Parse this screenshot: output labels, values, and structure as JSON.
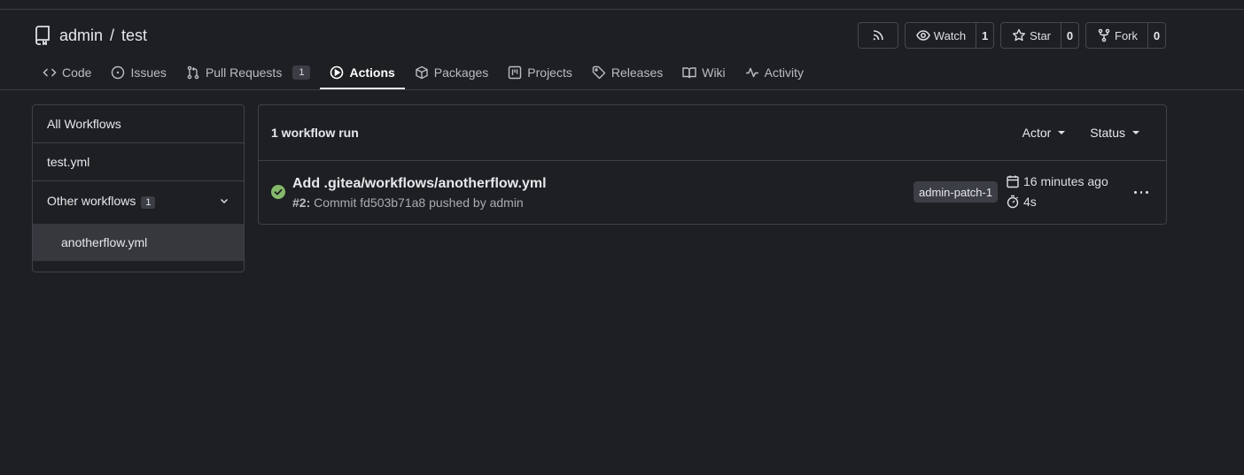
{
  "repo": {
    "owner": "admin",
    "separator": "/",
    "name": "test"
  },
  "actions": {
    "watch": {
      "label": "Watch",
      "count": "1"
    },
    "star": {
      "label": "Star",
      "count": "0"
    },
    "fork": {
      "label": "Fork",
      "count": "0"
    }
  },
  "tabs": [
    {
      "label": "Code",
      "icon": "code-icon"
    },
    {
      "label": "Issues",
      "icon": "issue-icon"
    },
    {
      "label": "Pull Requests",
      "icon": "pull-request-icon",
      "badge": "1"
    },
    {
      "label": "Actions",
      "icon": "play-icon",
      "active": true
    },
    {
      "label": "Packages",
      "icon": "package-icon"
    },
    {
      "label": "Projects",
      "icon": "project-icon"
    },
    {
      "label": "Releases",
      "icon": "tag-icon"
    },
    {
      "label": "Wiki",
      "icon": "book-icon"
    },
    {
      "label": "Activity",
      "icon": "pulse-icon"
    }
  ],
  "sidebar": {
    "all": "All Workflows",
    "workflow": "test.yml",
    "other": {
      "label": "Other workflows",
      "count": "1"
    },
    "sub": "anotherflow.yml"
  },
  "main": {
    "title": "1 workflow run",
    "filters": {
      "actor": "Actor",
      "status": "Status"
    },
    "runs": [
      {
        "title": "Add .gitea/workflows/anotherflow.yml",
        "number": "#2:",
        "description": "Commit fd503b71a8 pushed by admin",
        "branch": "admin-patch-1",
        "time": "16 minutes ago",
        "duration": "4s",
        "status_color": "#85b86b"
      }
    ]
  },
  "colors": {
    "background": "#1d1f22",
    "border": "#3e4147",
    "badge": "#3b3e44",
    "success": "#85b86b"
  }
}
